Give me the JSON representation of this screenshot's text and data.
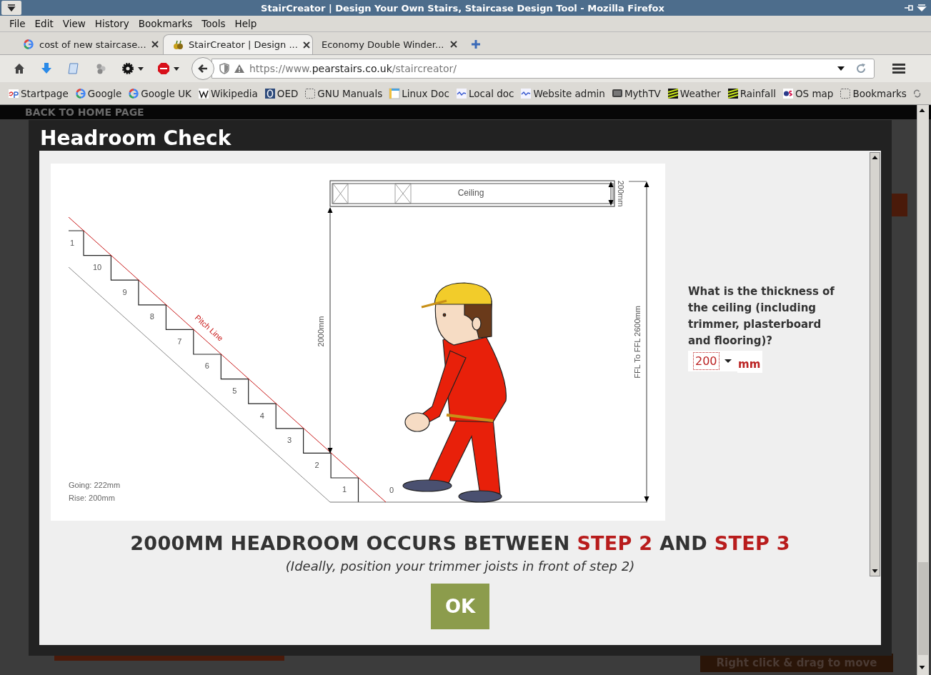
{
  "window": {
    "title": "StairCreator | Design Your Own Stairs, Staircase Design Tool - Mozilla Firefox"
  },
  "menu": [
    "File",
    "Edit",
    "View",
    "History",
    "Bookmarks",
    "Tools",
    "Help"
  ],
  "tabs": [
    {
      "label": "cost of new staircase...",
      "kind": "google",
      "selected": false
    },
    {
      "label": "StairCreator | Design ...",
      "kind": "site",
      "selected": true
    },
    {
      "label": "Economy Double Winder...",
      "kind": "none",
      "selected": false
    }
  ],
  "address_bar": {
    "scheme": "https://www.",
    "domain": "pearstairs.co.uk",
    "path": "/staircreator/"
  },
  "bookmarks": [
    {
      "label": "Startpage",
      "kind": "startpage"
    },
    {
      "label": "Google",
      "kind": "google"
    },
    {
      "label": "Google UK",
      "kind": "google"
    },
    {
      "label": "Wikipedia",
      "kind": "wikipedia"
    },
    {
      "label": "OED",
      "kind": "oed"
    },
    {
      "label": "GNU Manuals",
      "kind": "folder"
    },
    {
      "label": "Linux Doc",
      "kind": "doc"
    },
    {
      "label": "Local doc",
      "kind": "wave"
    },
    {
      "label": "Website admin",
      "kind": "wave"
    },
    {
      "label": "MythTV",
      "kind": "tv"
    },
    {
      "label": "Weather",
      "kind": "stripes"
    },
    {
      "label": "Rainfall",
      "kind": "stripes"
    },
    {
      "label": "OS map",
      "kind": "osmap"
    },
    {
      "label": "Bookmarks",
      "kind": "folder"
    }
  ],
  "page": {
    "back_link": "BACK TO HOME PAGE",
    "drag_hint": "Right click & drag to move"
  },
  "dialog": {
    "title": "Headroom Check",
    "diagram": {
      "step_labels": [
        "1",
        "10",
        "9",
        "8",
        "7",
        "6",
        "5",
        "4",
        "3",
        "2",
        "1",
        "0"
      ],
      "pitch_label": "Pitch Line",
      "ceiling_label": "Ceiling",
      "ceiling_thickness": "200mm",
      "headroom": "2000mm",
      "floor_to_floor": "FFL To FFL 2600mm",
      "going": "Going: 222mm",
      "rise": "Rise: 200mm"
    },
    "question": "What is the thickness of the ceiling (including trimmer, plasterboard and flooring)?",
    "thickness": {
      "value": "200",
      "unit": "mm"
    },
    "result": [
      {
        "text": "2000MM HEADROOM OCCURS BETWEEN ",
        "highlight": false
      },
      {
        "text": "STEP 2",
        "highlight": true
      },
      {
        "text": " AND ",
        "highlight": false
      },
      {
        "text": "STEP 3",
        "highlight": true
      }
    ],
    "hint": "(Ideally, position your trimmer joists in front of step 2)",
    "ok_button": "OK"
  }
}
